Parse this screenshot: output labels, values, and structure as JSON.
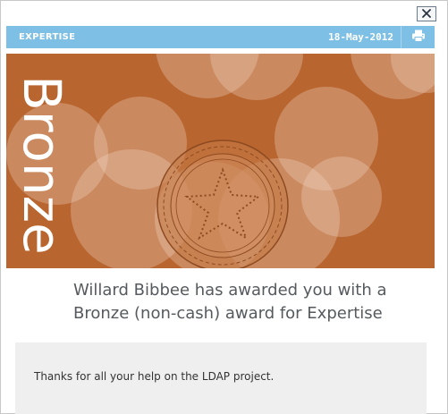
{
  "dialog": {
    "close_label": "✕"
  },
  "header": {
    "category": "EXPERTISE",
    "date": "18-May-2012",
    "print_icon": "printer-icon"
  },
  "banner": {
    "level": "Bronze",
    "background_color": "#b8652f"
  },
  "award": {
    "line1": "Willard Bibbee has awarded you with a",
    "line2": "Bronze (non-cash) award for Expertise"
  },
  "message": {
    "text": "Thanks for all your help on the LDAP project."
  }
}
